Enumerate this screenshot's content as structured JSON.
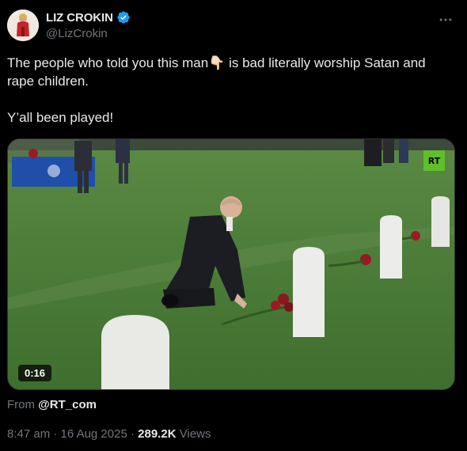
{
  "author": {
    "display_name": "LIZ CROKIN",
    "handle": "@LizCrokin",
    "verified_icon": "verified-badge-icon",
    "accent_color": "#1d9bf0"
  },
  "tweet": {
    "line1": "The people who told you this man👇🏻 is bad literally worship Satan and rape children.",
    "line2": "Y’all been played!"
  },
  "media": {
    "duration": "0:16",
    "watermark": "RT"
  },
  "source": {
    "prefix": "From",
    "handle": "@RT_com"
  },
  "meta": {
    "time": "8:47 am",
    "separator": "·",
    "date": "16 Aug 2025",
    "views_count": "289.2K",
    "views_label": "Views"
  },
  "icons": {
    "more": "more-horizontal-icon"
  }
}
